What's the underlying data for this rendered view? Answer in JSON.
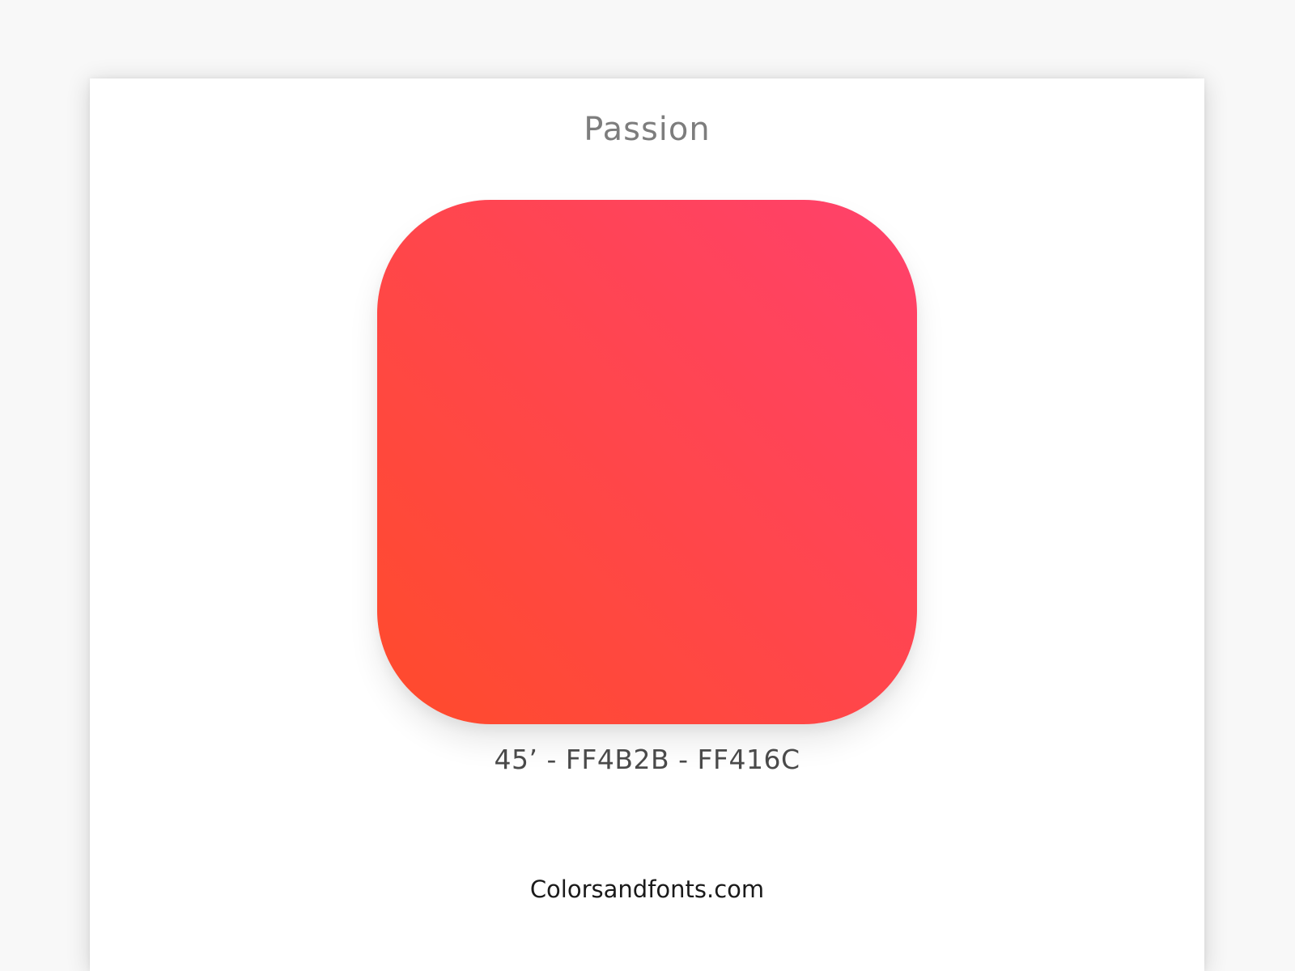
{
  "title": "Passion",
  "gradient": {
    "angle": "45’",
    "color_start": "#FF4B2B",
    "color_end": "#FF416C",
    "label": "45’ - FF4B2B - FF416C"
  },
  "footer": {
    "site": "Colorsandfonts.com"
  }
}
